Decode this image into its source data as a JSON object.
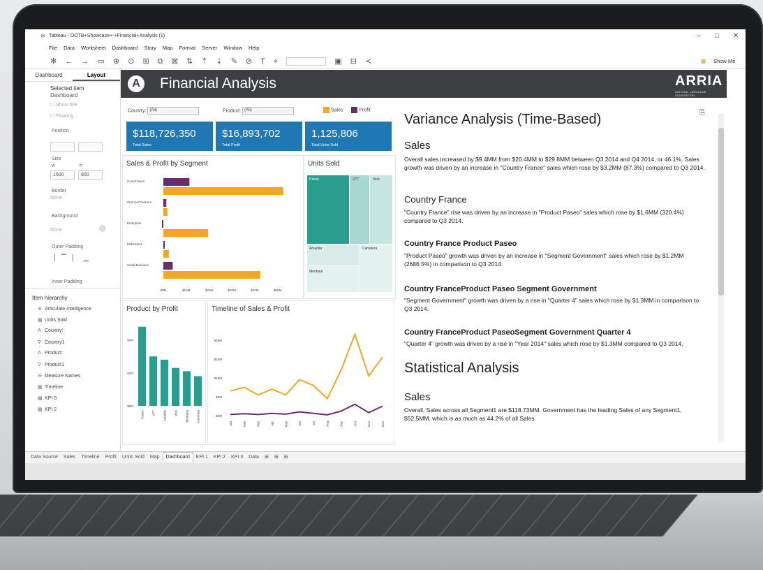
{
  "window": {
    "title": "Tableau - OOTB+Showcase+-+Financial+Analysis (1)"
  },
  "menu": [
    "File",
    "Data",
    "Worksheet",
    "Dashboard",
    "Story",
    "Map",
    "Format",
    "Server",
    "Window",
    "Help"
  ],
  "toolbar": {
    "show_me": "Show Me"
  },
  "left_pane": {
    "tabs": [
      "Dashboard",
      "Layout"
    ],
    "selected_item_label": "Selected item",
    "selected_item_value": "Dashboard",
    "show_title": "Show title",
    "floating": "Floating",
    "position_label": "Position",
    "size_label": "Size",
    "w_label": "w",
    "h_label": "h",
    "w_value": "1500",
    "h_value": "800",
    "border_label": "Border",
    "border_value": "None",
    "background_label": "Background",
    "background_value": "None",
    "outer_padding_label": "Outer Padding",
    "inner_padding_label": "Inner Padding",
    "hierarchy_title": "Item hierarchy",
    "hierarchy": [
      {
        "icon": "⊕",
        "label": "Articulate Intelligence"
      },
      {
        "icon": "▦",
        "label": "Units Sold"
      },
      {
        "icon": "A",
        "label": "Country:"
      },
      {
        "icon": "∇",
        "label": "Country1"
      },
      {
        "icon": "A",
        "label": "Product:"
      },
      {
        "icon": "∇",
        "label": "Product1"
      },
      {
        "icon": "☰",
        "label": "Measure Names"
      },
      {
        "icon": "▦",
        "label": "Timeline"
      },
      {
        "icon": "▦",
        "label": "KPI 3"
      },
      {
        "icon": "▦",
        "label": "KPI 2"
      }
    ]
  },
  "dashboard": {
    "title": "Financial Analysis",
    "brand": "ARRIA",
    "brand_sub": "NATURAL LANGUAGE GENERATION",
    "filters": {
      "country_label": "Country:",
      "country_value": "(All)",
      "product_label": "Product:",
      "product_value": "(All)"
    },
    "legend": [
      {
        "name": "Sales",
        "color": "#f5a623"
      },
      {
        "name": "Profit",
        "color": "#6b2c6e"
      }
    ],
    "kpis": [
      {
        "value": "$118,726,350",
        "label": "Total Sales"
      },
      {
        "value": "$16,893,702",
        "label": "Total Profit"
      },
      {
        "value": "1,125,806",
        "label": "Total Units Sold"
      }
    ],
    "units_sold_title": "Units Sold",
    "treemap_labels": [
      "Paseo",
      "VTT",
      "Velo",
      "Amarilla",
      "Carretera",
      "Montana"
    ]
  },
  "chart_data": [
    {
      "type": "bar",
      "title": "Sales & Profit by Segment",
      "categories": [
        "Government",
        "Channel Partners",
        "Enterprise",
        "Midmarket",
        "Small Business"
      ],
      "series": [
        {
          "name": "Profit",
          "values": [
            11.4,
            1.3,
            -0.6,
            0.6,
            4.1
          ]
        },
        {
          "name": "Sales",
          "values": [
            52.5,
            1.8,
            19.6,
            2.4,
            42.4
          ]
        }
      ],
      "x_ticks": [
        "$0M",
        "$10M",
        "$20M",
        "$30M",
        "$40M",
        "$50M"
      ],
      "xlim": [
        0,
        55
      ]
    },
    {
      "type": "bar",
      "title": "Product by Profit",
      "categories": [
        "Paseo",
        "VTT",
        "Amarilla",
        "Velo",
        "Montana",
        "Carretera"
      ],
      "values": [
        4.8,
        3.0,
        2.8,
        2.3,
        2.1,
        1.8
      ],
      "y_ticks": [
        "$0M",
        "$2M",
        "$4M"
      ],
      "ylim": [
        0,
        5
      ]
    },
    {
      "type": "line",
      "title": "Timeline of Sales & Profit",
      "categories": [
        "Jan",
        "Feb",
        "Mar",
        "Apr",
        "May",
        "Jun",
        "Jul",
        "Aug",
        "Sep",
        "Oct",
        "Nov",
        "Dec"
      ],
      "series": [
        {
          "name": "Sales",
          "values": [
            6.5,
            7.5,
            5.5,
            7,
            5.5,
            9.5,
            8,
            4.5,
            12,
            21.5,
            10.5,
            15.5
          ]
        },
        {
          "name": "Profit",
          "values": [
            0.3,
            0.5,
            0.3,
            0.6,
            0.4,
            1.0,
            0.6,
            0.2,
            1.2,
            3.0,
            0.8,
            2.5
          ]
        }
      ],
      "y_ticks": [
        "$0M",
        "$5M",
        "$10M",
        "$15M",
        "$20M"
      ],
      "ylim": [
        0,
        22
      ]
    }
  ],
  "narrative": {
    "title": "Variance Analysis (Time-Based)",
    "sections": [
      {
        "heading": "Sales",
        "style": "h2",
        "text": "Overall sales increased by $9.4MM from $20.4MM to $29.8MM between Q3 2014 and Q4 2014, or 46.1%. Sales growth was driven by an increase in \"Country France\" sales which rose by $3.2MM (87.3%) compared to Q3 2014."
      },
      {
        "heading": "Country France",
        "style": "h2s",
        "text": "\"Country France\" rise was driven by an increase in \"Product Paseo\" sales which rose by $1.6MM (320.4%) compared to Q3 2014."
      },
      {
        "heading": "Country France Product Paseo",
        "style": "h3",
        "text": "\"Product Paseo\" growth was driven by an increase in \"Segment Government\" sales which rose by $1.2MM (2686.5%) in comparison to Q3 2014."
      },
      {
        "heading": "Country FranceProduct Paseo Segment Government",
        "style": "h3",
        "text": "\"Segment Government\" growth was driven by a rise in \"Quarter 4\" sales which rose by $1.3MM in comparison to Q3 2014."
      },
      {
        "heading": "Country FranceProduct PaseoSegment Government Quarter 4",
        "style": "h3",
        "text": "\"Quarter 4\" growth was driven by a rise in \"Year 2014\" sales which rose by $1.3MM compared to Q3 2014."
      }
    ],
    "title2": "Statistical Analysis",
    "stat_heading": "Sales",
    "stat_text": "Overall, Sales across all Segment1 are $118.73MM. Government has the leading Sales of any Segment1, $52.5MM, which is as much as 44.2% of all Sales."
  },
  "sheet_tabs": [
    "Data Source",
    "Sales",
    "Timeline",
    "Profit",
    "Units Sold",
    "Map",
    "Dashboard",
    "KPI 1",
    "KPI 2",
    "KPI 3",
    "Data"
  ],
  "active_tab": "Dashboard"
}
